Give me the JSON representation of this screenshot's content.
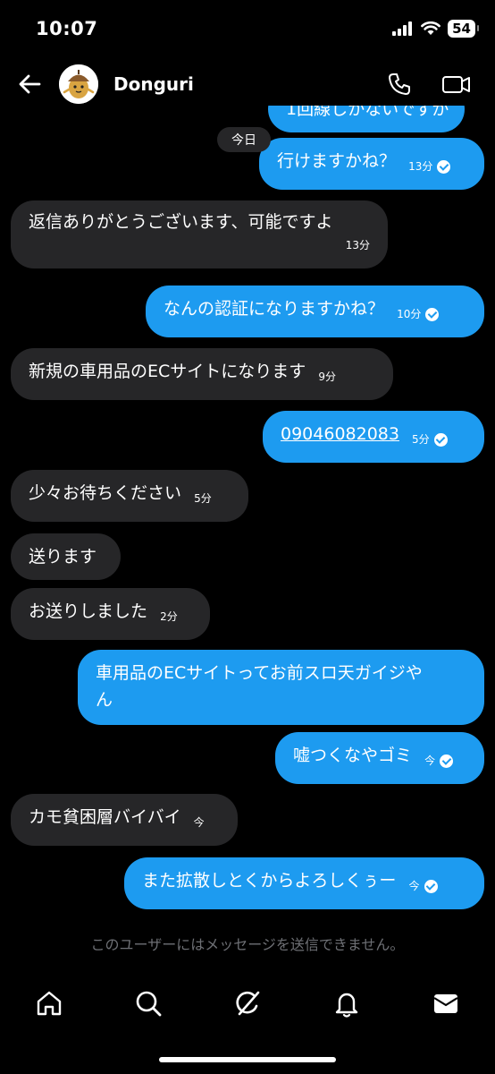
{
  "status": {
    "time": "10:07",
    "battery": "54"
  },
  "header": {
    "name": "Donguri"
  },
  "thread": {
    "cut_message": "1回線しかないですが",
    "day_separator": "今日",
    "messages": [
      {
        "dir": "out",
        "text": "行けますかね？",
        "time": "13分",
        "seen": true
      },
      {
        "dir": "in",
        "text": "返信ありがとうございます、可能ですよ",
        "time": "13分"
      },
      {
        "dir": "out",
        "text": "なんの認証になりますかね？",
        "time": "10分",
        "seen": true
      },
      {
        "dir": "in",
        "text": "新規の車用品のECサイトになります",
        "time": "9分"
      },
      {
        "dir": "out",
        "text": "09046082083",
        "time": "5分",
        "seen": true
      },
      {
        "dir": "in",
        "text": "少々お待ちください",
        "time": "5分"
      },
      {
        "dir": "in",
        "text": "送ります",
        "time": ""
      },
      {
        "dir": "in",
        "text": "お送りしました",
        "time": "2分"
      },
      {
        "dir": "out",
        "text": "車用品のECサイトってお前スロ天ガイジや",
        "text2": "ん",
        "time": "",
        "seen": false
      },
      {
        "dir": "out",
        "text": "嘘つくなやゴミ",
        "time": "今",
        "seen": true
      },
      {
        "dir": "in",
        "text": "カモ貧困層バイバイ",
        "time": "今"
      },
      {
        "dir": "out",
        "text": "また拡散しとくからよろしくぅー",
        "time": "今",
        "seen": true
      }
    ]
  },
  "footer": {
    "notice": "このユーザーにはメッセージを送信できません。"
  },
  "tabbar": {
    "items": [
      "home-icon",
      "search-icon",
      "grok-icon",
      "notifications-icon",
      "messages-icon"
    ]
  },
  "colors": {
    "outgoing": "#1d9bf0",
    "incoming": "#262628",
    "background": "#000000"
  }
}
